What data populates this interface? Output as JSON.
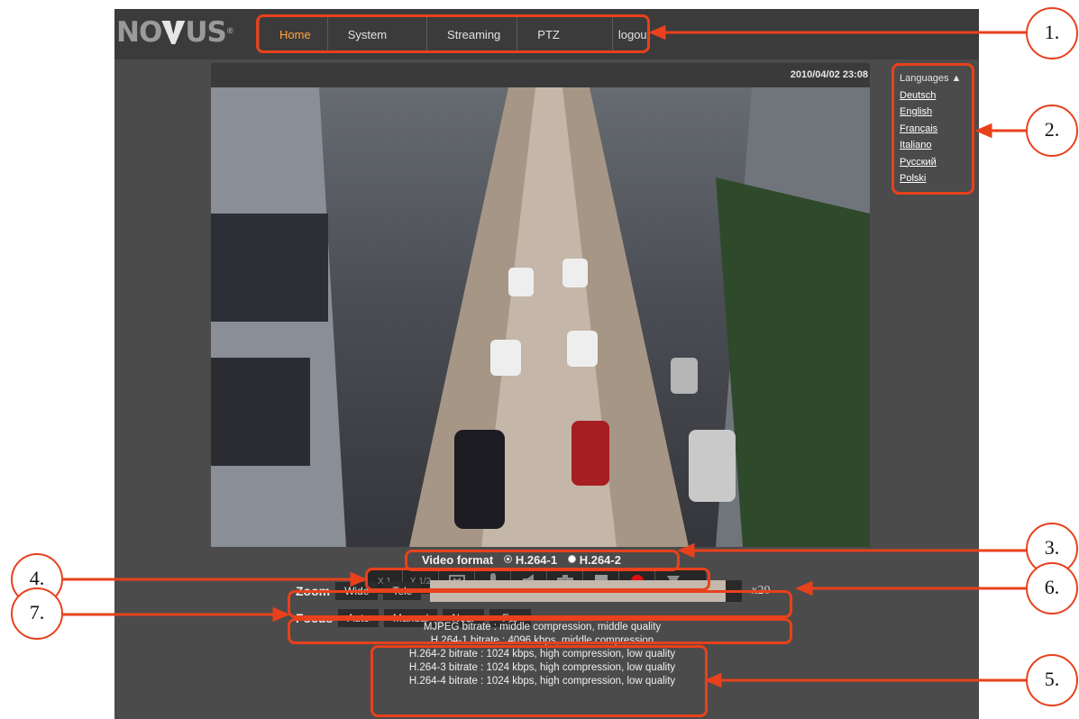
{
  "logo": {
    "text": "NO",
    "text2": "US",
    "mark": "®"
  },
  "menu": [
    {
      "label": "Home",
      "active": true
    },
    {
      "label": "System",
      "active": false
    },
    {
      "label": "Streaming",
      "active": false
    },
    {
      "label": "PTZ",
      "active": false
    },
    {
      "label": "logout",
      "active": false
    }
  ],
  "timestamp": "2010/04/02 23:08",
  "languages": {
    "title": "Languages",
    "items": [
      "Deutsch",
      "English",
      "Français",
      "Italiano",
      "Русский",
      "Polski"
    ]
  },
  "video_format": {
    "label": "Video format",
    "options": [
      "H.264-1",
      "H.264-2"
    ],
    "selected": "H.264-1"
  },
  "toolbar": {
    "items": [
      "x1-button",
      "x1/2-button",
      "fullscreen-icon",
      "microphone-icon",
      "speaker-icon",
      "snapshot-icon",
      "stop-icon",
      "record-icon",
      "dropdown-icon"
    ],
    "x1": "X 1",
    "x12": "X 1/2"
  },
  "zoom": {
    "label": "Zoom",
    "wide": "Wide",
    "tele": "Tele",
    "value": "x20"
  },
  "focus": {
    "label": "Focus",
    "auto": "Auto",
    "manual": "Manual",
    "near": "Near",
    "far": "Far"
  },
  "bitrate": [
    "MJPEG bitrate : middle compression, middle quality",
    "H.264-1 bitrate : 4096 kbps, middle compression",
    "H.264-2 bitrate : 1024 kbps, high compression, low quality",
    "H.264-3 bitrate : 1024 kbps, high compression, low quality",
    "H.264-4 bitrate : 1024 kbps, high compression, low quality"
  ],
  "callouts": [
    "1.",
    "2.",
    "3.",
    "4.",
    "5.",
    "6.",
    "7."
  ],
  "colors": {
    "callout": "#e8411c",
    "active_menu": "#ffa43c",
    "record": "#e01010"
  }
}
